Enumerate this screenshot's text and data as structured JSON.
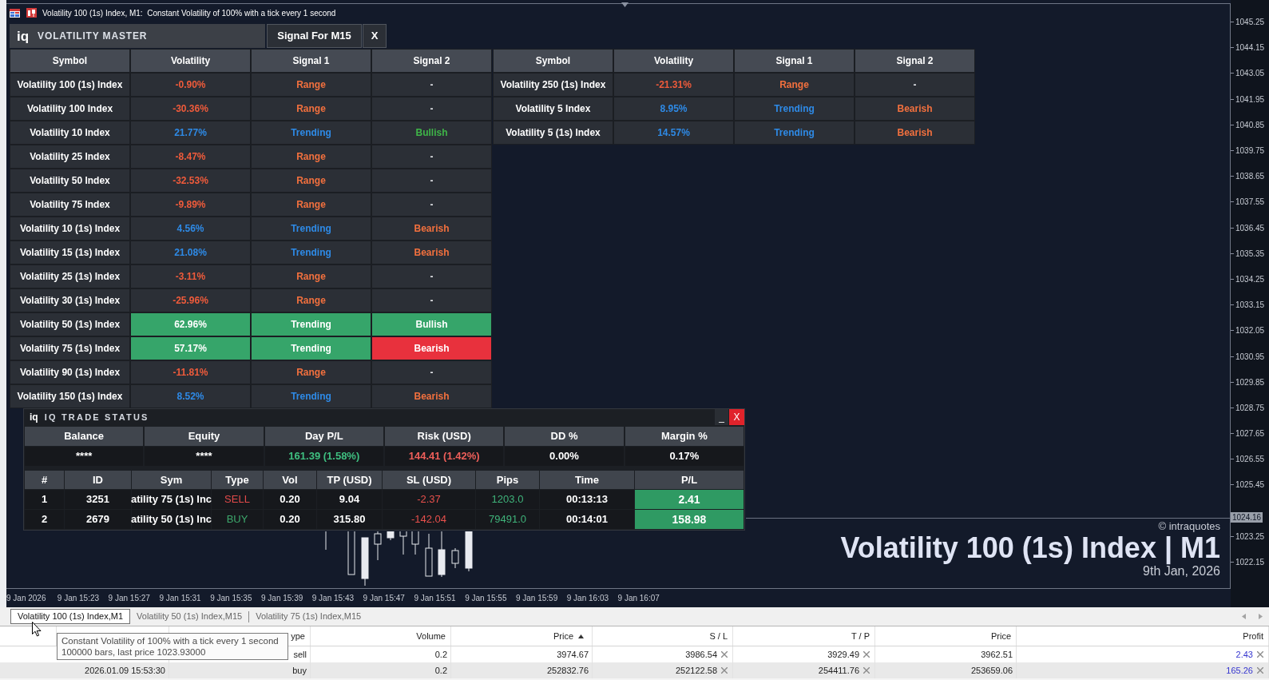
{
  "chart_title": "Volatility 100 (1s) Index, M1:  Constant Volatility of 100% with a tick every 1 second",
  "volatility_master": {
    "logo": "iq",
    "title": "VOLATILITY MASTER",
    "timeframe_button": "Signal For M15",
    "close_button": "X",
    "tables": [
      {
        "columns": [
          "Symbol",
          "Volatility",
          "Signal 1",
          "Signal 2"
        ],
        "rows": [
          {
            "highlighted": false,
            "cells": [
              {
                "text": "Volatility 100 (1s) Index",
                "kind": "symbol"
              },
              {
                "text": "-0.90%",
                "kind": "negative"
              },
              {
                "text": "Range",
                "kind": "range"
              },
              {
                "text": "-",
                "kind": "none"
              }
            ]
          },
          {
            "highlighted": false,
            "cells": [
              {
                "text": "Volatility 100 Index",
                "kind": "symbol"
              },
              {
                "text": "-30.36%",
                "kind": "negative"
              },
              {
                "text": "Range",
                "kind": "range"
              },
              {
                "text": "-",
                "kind": "none"
              }
            ]
          },
          {
            "highlighted": false,
            "cells": [
              {
                "text": "Volatility 10 Index",
                "kind": "symbol"
              },
              {
                "text": "21.77%",
                "kind": "positive"
              },
              {
                "text": "Trending",
                "kind": "trending"
              },
              {
                "text": "Bullish",
                "kind": "bullish"
              }
            ]
          },
          {
            "highlighted": false,
            "cells": [
              {
                "text": "Volatility 25 Index",
                "kind": "symbol"
              },
              {
                "text": "-8.47%",
                "kind": "negative"
              },
              {
                "text": "Range",
                "kind": "range"
              },
              {
                "text": "-",
                "kind": "none"
              }
            ]
          },
          {
            "highlighted": false,
            "cells": [
              {
                "text": "Volatility 50 Index",
                "kind": "symbol"
              },
              {
                "text": "-32.53%",
                "kind": "negative"
              },
              {
                "text": "Range",
                "kind": "range"
              },
              {
                "text": "-",
                "kind": "none"
              }
            ]
          },
          {
            "highlighted": false,
            "cells": [
              {
                "text": "Volatility 75 Index",
                "kind": "symbol"
              },
              {
                "text": "-9.89%",
                "kind": "negative"
              },
              {
                "text": "Range",
                "kind": "range"
              },
              {
                "text": "-",
                "kind": "none"
              }
            ]
          },
          {
            "highlighted": false,
            "cells": [
              {
                "text": "Volatility 10 (1s) Index",
                "kind": "symbol"
              },
              {
                "text": "4.56%",
                "kind": "positive"
              },
              {
                "text": "Trending",
                "kind": "trending"
              },
              {
                "text": "Bearish",
                "kind": "bearish"
              }
            ]
          },
          {
            "highlighted": false,
            "cells": [
              {
                "text": "Volatility 15 (1s) Index",
                "kind": "symbol"
              },
              {
                "text": "21.08%",
                "kind": "positive"
              },
              {
                "text": "Trending",
                "kind": "trending"
              },
              {
                "text": "Bearish",
                "kind": "bearish"
              }
            ]
          },
          {
            "highlighted": false,
            "cells": [
              {
                "text": "Volatility 25 (1s) Index",
                "kind": "symbol"
              },
              {
                "text": "-3.11%",
                "kind": "negative"
              },
              {
                "text": "Range",
                "kind": "range"
              },
              {
                "text": "-",
                "kind": "none"
              }
            ]
          },
          {
            "highlighted": false,
            "cells": [
              {
                "text": "Volatility 30 (1s) Index",
                "kind": "symbol"
              },
              {
                "text": "-25.96%",
                "kind": "negative"
              },
              {
                "text": "Range",
                "kind": "range"
              },
              {
                "text": "-",
                "kind": "none"
              }
            ]
          },
          {
            "highlighted": true,
            "cells": [
              {
                "text": "Volatility 50 (1s) Index",
                "kind": "symbol"
              },
              {
                "text": "62.96%",
                "kind": "positive"
              },
              {
                "text": "Trending",
                "kind": "trending"
              },
              {
                "text": "Bullish",
                "kind": "bullish"
              }
            ]
          },
          {
            "highlighted": true,
            "cells": [
              {
                "text": "Volatility 75 (1s) Index",
                "kind": "symbol"
              },
              {
                "text": "57.17%",
                "kind": "positive"
              },
              {
                "text": "Trending",
                "kind": "trending"
              },
              {
                "text": "Bearish",
                "kind": "bearish"
              }
            ]
          },
          {
            "highlighted": false,
            "cells": [
              {
                "text": "Volatility 90 (1s) Index",
                "kind": "symbol"
              },
              {
                "text": "-11.81%",
                "kind": "negative"
              },
              {
                "text": "Range",
                "kind": "range"
              },
              {
                "text": "-",
                "kind": "none"
              }
            ]
          },
          {
            "highlighted": false,
            "cells": [
              {
                "text": "Volatility 150 (1s) Index",
                "kind": "symbol"
              },
              {
                "text": "8.52%",
                "kind": "positive"
              },
              {
                "text": "Trending",
                "kind": "trending"
              },
              {
                "text": "Bearish",
                "kind": "bearish"
              }
            ]
          }
        ]
      },
      {
        "columns": [
          "Symbol",
          "Volatility",
          "Signal 1",
          "Signal 2"
        ],
        "rows": [
          {
            "highlighted": false,
            "cells": [
              {
                "text": "Volatility 250 (1s) Index",
                "kind": "symbol"
              },
              {
                "text": "-21.31%",
                "kind": "negative"
              },
              {
                "text": "Range",
                "kind": "range"
              },
              {
                "text": "-",
                "kind": "none"
              }
            ]
          },
          {
            "highlighted": false,
            "cells": [
              {
                "text": "Volatility 5 Index",
                "kind": "symbol"
              },
              {
                "text": "8.95%",
                "kind": "positive"
              },
              {
                "text": "Trending",
                "kind": "trending"
              },
              {
                "text": "Bearish",
                "kind": "bearish"
              }
            ]
          },
          {
            "highlighted": false,
            "cells": [
              {
                "text": "Volatility 5 (1s) Index",
                "kind": "symbol"
              },
              {
                "text": "14.57%",
                "kind": "positive"
              },
              {
                "text": "Trending",
                "kind": "trending"
              },
              {
                "text": "Bearish",
                "kind": "bearish"
              }
            ]
          }
        ]
      }
    ]
  },
  "trade_status": {
    "logo": "iq",
    "title": "IQ TRADE STATUS",
    "minimize_button": "_",
    "close_button": "X",
    "summary": [
      {
        "label": "Balance",
        "value": "****",
        "kind": "neutral"
      },
      {
        "label": "Equity",
        "value": "****",
        "kind": "neutral"
      },
      {
        "label": "Day P/L",
        "value": "161.39 (1.58%)",
        "kind": "gain"
      },
      {
        "label": "Risk (USD)",
        "value": "144.41 (1.42%)",
        "kind": "loss"
      },
      {
        "label": "DD %",
        "value": "0.00%",
        "kind": "neutral"
      },
      {
        "label": "Margin %",
        "value": "0.17%",
        "kind": "neutral"
      }
    ],
    "positions": {
      "columns": [
        "#",
        "ID",
        "Sym",
        "Type",
        "Vol",
        "TP (USD)",
        "SL (USD)",
        "Pips",
        "Time",
        "P/L"
      ],
      "rows": [
        {
          "kind": "sell",
          "cells": [
            "1",
            "3251",
            "atility 75 (1s) Inc",
            "SELL",
            "0.20",
            "9.04",
            "-2.37",
            "1203.0",
            "00:13:13",
            "2.41"
          ]
        },
        {
          "kind": "buy",
          "cells": [
            "2",
            "2679",
            "atility 50 (1s) Inc",
            "BUY",
            "0.20",
            "315.80",
            "-142.04",
            "79491.0",
            "00:14:01",
            "158.98"
          ]
        }
      ]
    }
  },
  "chart_label": {
    "copyright": "© intraquotes",
    "symbol": "Volatility 100 (1s) Index | M1",
    "date": "9th Jan, 2026"
  },
  "price_axis": [
    {
      "kind": "tick",
      "label": "1045.25"
    },
    {
      "kind": "tick",
      "label": "1044.15"
    },
    {
      "kind": "tick",
      "label": "1043.05"
    },
    {
      "kind": "tick",
      "label": "1041.95"
    },
    {
      "kind": "tick",
      "label": "1040.85"
    },
    {
      "kind": "tick",
      "label": "1039.75"
    },
    {
      "kind": "tick",
      "label": "1038.65"
    },
    {
      "kind": "tick",
      "label": "1037.55"
    },
    {
      "kind": "tick",
      "label": "1036.45"
    },
    {
      "kind": "tick",
      "label": "1035.35"
    },
    {
      "kind": "tick",
      "label": "1034.25"
    },
    {
      "kind": "tick",
      "label": "1033.15"
    },
    {
      "kind": "tick",
      "label": "1032.05"
    },
    {
      "kind": "tick",
      "label": "1030.95"
    },
    {
      "kind": "tick",
      "label": "1029.85"
    },
    {
      "kind": "tick",
      "label": "1028.75"
    },
    {
      "kind": "tick",
      "label": "1027.65"
    },
    {
      "kind": "tick",
      "label": "1026.55"
    },
    {
      "kind": "tick",
      "label": "1025.45"
    },
    {
      "kind": "current",
      "label": "1024.16"
    },
    {
      "kind": "tick",
      "label": "1023.25"
    },
    {
      "kind": "tick",
      "label": "1022.15"
    }
  ],
  "time_axis": [
    "9 Jan 2026",
    "9 Jan 15:23",
    "9 Jan 15:27",
    "9 Jan 15:31",
    "9 Jan 15:35",
    "9 Jan 15:39",
    "9 Jan 15:43",
    "9 Jan 15:47",
    "9 Jan 15:51",
    "9 Jan 15:55",
    "9 Jan 15:59",
    "9 Jan 16:03",
    "9 Jan 16:07"
  ],
  "chart_tabs": [
    {
      "label": "Volatility 100 (1s) Index,M1",
      "selected": true
    },
    {
      "label": "Volatility 50 (1s) Index,M15",
      "selected": false
    },
    {
      "label": "Volatility 75 (1s) Index,M15",
      "selected": false
    }
  ],
  "toolbox": {
    "columns": [
      {
        "label": "ype",
        "sorted": false
      },
      {
        "label": "Volume",
        "sorted": false
      },
      {
        "label": "Price",
        "sorted": true
      },
      {
        "label": "S / L",
        "sorted": false
      },
      {
        "label": "T / P",
        "sorted": false
      },
      {
        "label": "Price",
        "sorted": false
      },
      {
        "label": "Profit",
        "sorted": false
      }
    ],
    "rows": [
      {
        "cells": [
          {
            "text": "sell",
            "kind": "plain"
          },
          {
            "text": "0.2",
            "kind": "plain"
          },
          {
            "text": "3974.67",
            "kind": "plain"
          },
          {
            "text": "3986.54",
            "kind": "closable"
          },
          {
            "text": "3929.49",
            "kind": "closable"
          },
          {
            "text": "3962.51",
            "kind": "plain"
          },
          {
            "text": "2.43",
            "kind": "profit"
          }
        ]
      },
      {
        "time": "2026.01.09 15:53:30",
        "cells": [
          {
            "text": "buy",
            "kind": "plain"
          },
          {
            "text": "0.2",
            "kind": "plain"
          },
          {
            "text": "252832.76",
            "kind": "plain"
          },
          {
            "text": "252122.58",
            "kind": "closable"
          },
          {
            "text": "254411.76",
            "kind": "closable"
          },
          {
            "text": "253659.06",
            "kind": "plain"
          },
          {
            "text": "165.26",
            "kind": "profit"
          }
        ]
      }
    ]
  },
  "tooltip": {
    "lines": [
      "Constant Volatility of 100% with a tick every 1 second",
      "100000 bars, last price 1023.93000"
    ]
  }
}
